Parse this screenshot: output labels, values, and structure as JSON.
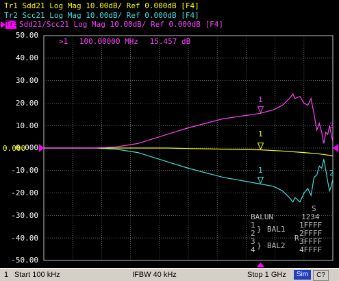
{
  "headers": {
    "tr1": "Tr1 Sdd21 Log Mag 10.00dB/ Ref 0.000dB [F4]",
    "tr2": "Tr2 Scc21 Log Mag 10.00dB/ Ref 0.000dB [F4]",
    "tr3_box": "Tr3",
    "tr3": "Sdd21/Scc21 Log Mag 10.00dB/ Ref 0.000dB [F4]"
  },
  "y_axis_labels": [
    "50.00",
    "40.00",
    "30.00",
    "20.00",
    "10.00",
    "0.000",
    "-10.00",
    "-20.00",
    "-30.00",
    "-40.00",
    "-50.00"
  ],
  "marker_readout": {
    "prefix": ">1",
    "frequency": "100.00000 MHz",
    "value": "15.457 dB"
  },
  "markers": [
    {
      "label": "1",
      "trace": "Tr3",
      "color": "#ff44ff"
    },
    {
      "label": "1",
      "trace": "Tr1",
      "color": "#ffff00"
    },
    {
      "label": "1",
      "trace": "Tr2",
      "color": "#40e0e0"
    }
  ],
  "trace_end_labels": {
    "tr3": "3",
    "tr1": "1",
    "tr2": "2"
  },
  "balun": {
    "title": "BALUN",
    "s_header": "S",
    "ports_header": "1234",
    "rows": [
      {
        "port": "1",
        "s": "1FFFF"
      },
      {
        "port": "2",
        "s": "2FFFF"
      },
      {
        "port": "3",
        "s": "3FFFF"
      },
      {
        "port": "4",
        "s": "4FFFF"
      }
    ],
    "bal1": "BAL1",
    "bal2": "BAL2",
    "r_label": "R"
  },
  "status_bar": {
    "channel": "1",
    "start": "Start 100 kHz",
    "ifbw": "IFBW 40 kHz",
    "stop": "Stop 1 GHz",
    "sim": "Sim",
    "c": "C?"
  },
  "colors": {
    "tr1": "#ffff00",
    "tr2": "#40e0e0",
    "tr3": "#ff44ff",
    "grid": "#808080",
    "background": "#000000"
  },
  "chart_data": {
    "type": "line",
    "ylim": [
      -50,
      50
    ],
    "y_divisions": 10,
    "x_start": "100 kHz",
    "x_stop": "1 GHz",
    "x_scale": "log",
    "x_range_hz": [
      100000,
      1000000000
    ],
    "series": [
      {
        "name": "Tr1",
        "color": "#ffff00",
        "x": [
          100000,
          1000000,
          5000000,
          10000000,
          30000000,
          100000000,
          200000000,
          400000000,
          600000000,
          800000000,
          1000000000
        ],
        "y": [
          0,
          0,
          0,
          -0.2,
          -0.5,
          -0.8,
          -1.3,
          -2,
          -2.5,
          -3,
          -3.5
        ]
      },
      {
        "name": "Tr2",
        "color": "#40e0e0",
        "x": [
          100000,
          500000,
          1000000,
          2000000,
          5000000,
          10000000,
          30000000,
          100000000,
          150000000,
          200000000,
          250000000,
          280000000,
          300000000,
          350000000,
          400000000,
          450000000,
          500000000,
          550000000,
          600000000,
          650000000,
          700000000,
          750000000,
          800000000,
          850000000,
          900000000,
          950000000,
          1000000000
        ],
        "y": [
          0,
          0,
          -0.5,
          -2,
          -6,
          -9,
          -13,
          -16,
          -17,
          -19,
          -22,
          -24,
          -22,
          -24,
          -20,
          -18,
          -21,
          -13,
          -12,
          -8,
          -9,
          -5,
          -10,
          -15,
          -19,
          -17,
          -14
        ]
      },
      {
        "name": "Tr3",
        "color": "#ff44ff",
        "x": [
          100000,
          500000,
          1000000,
          2000000,
          5000000,
          10000000,
          30000000,
          100000000,
          150000000,
          200000000,
          250000000,
          280000000,
          300000000,
          350000000,
          400000000,
          450000000,
          500000000,
          550000000,
          600000000,
          650000000,
          700000000,
          750000000,
          800000000,
          850000000,
          900000000,
          950000000,
          1000000000
        ],
        "y": [
          0,
          0,
          0.5,
          2,
          6,
          9,
          13,
          15.457,
          17,
          19,
          22,
          24,
          22,
          23,
          20,
          19,
          22,
          15,
          8,
          11,
          7,
          2,
          7,
          6,
          10,
          6,
          3
        ]
      }
    ]
  }
}
